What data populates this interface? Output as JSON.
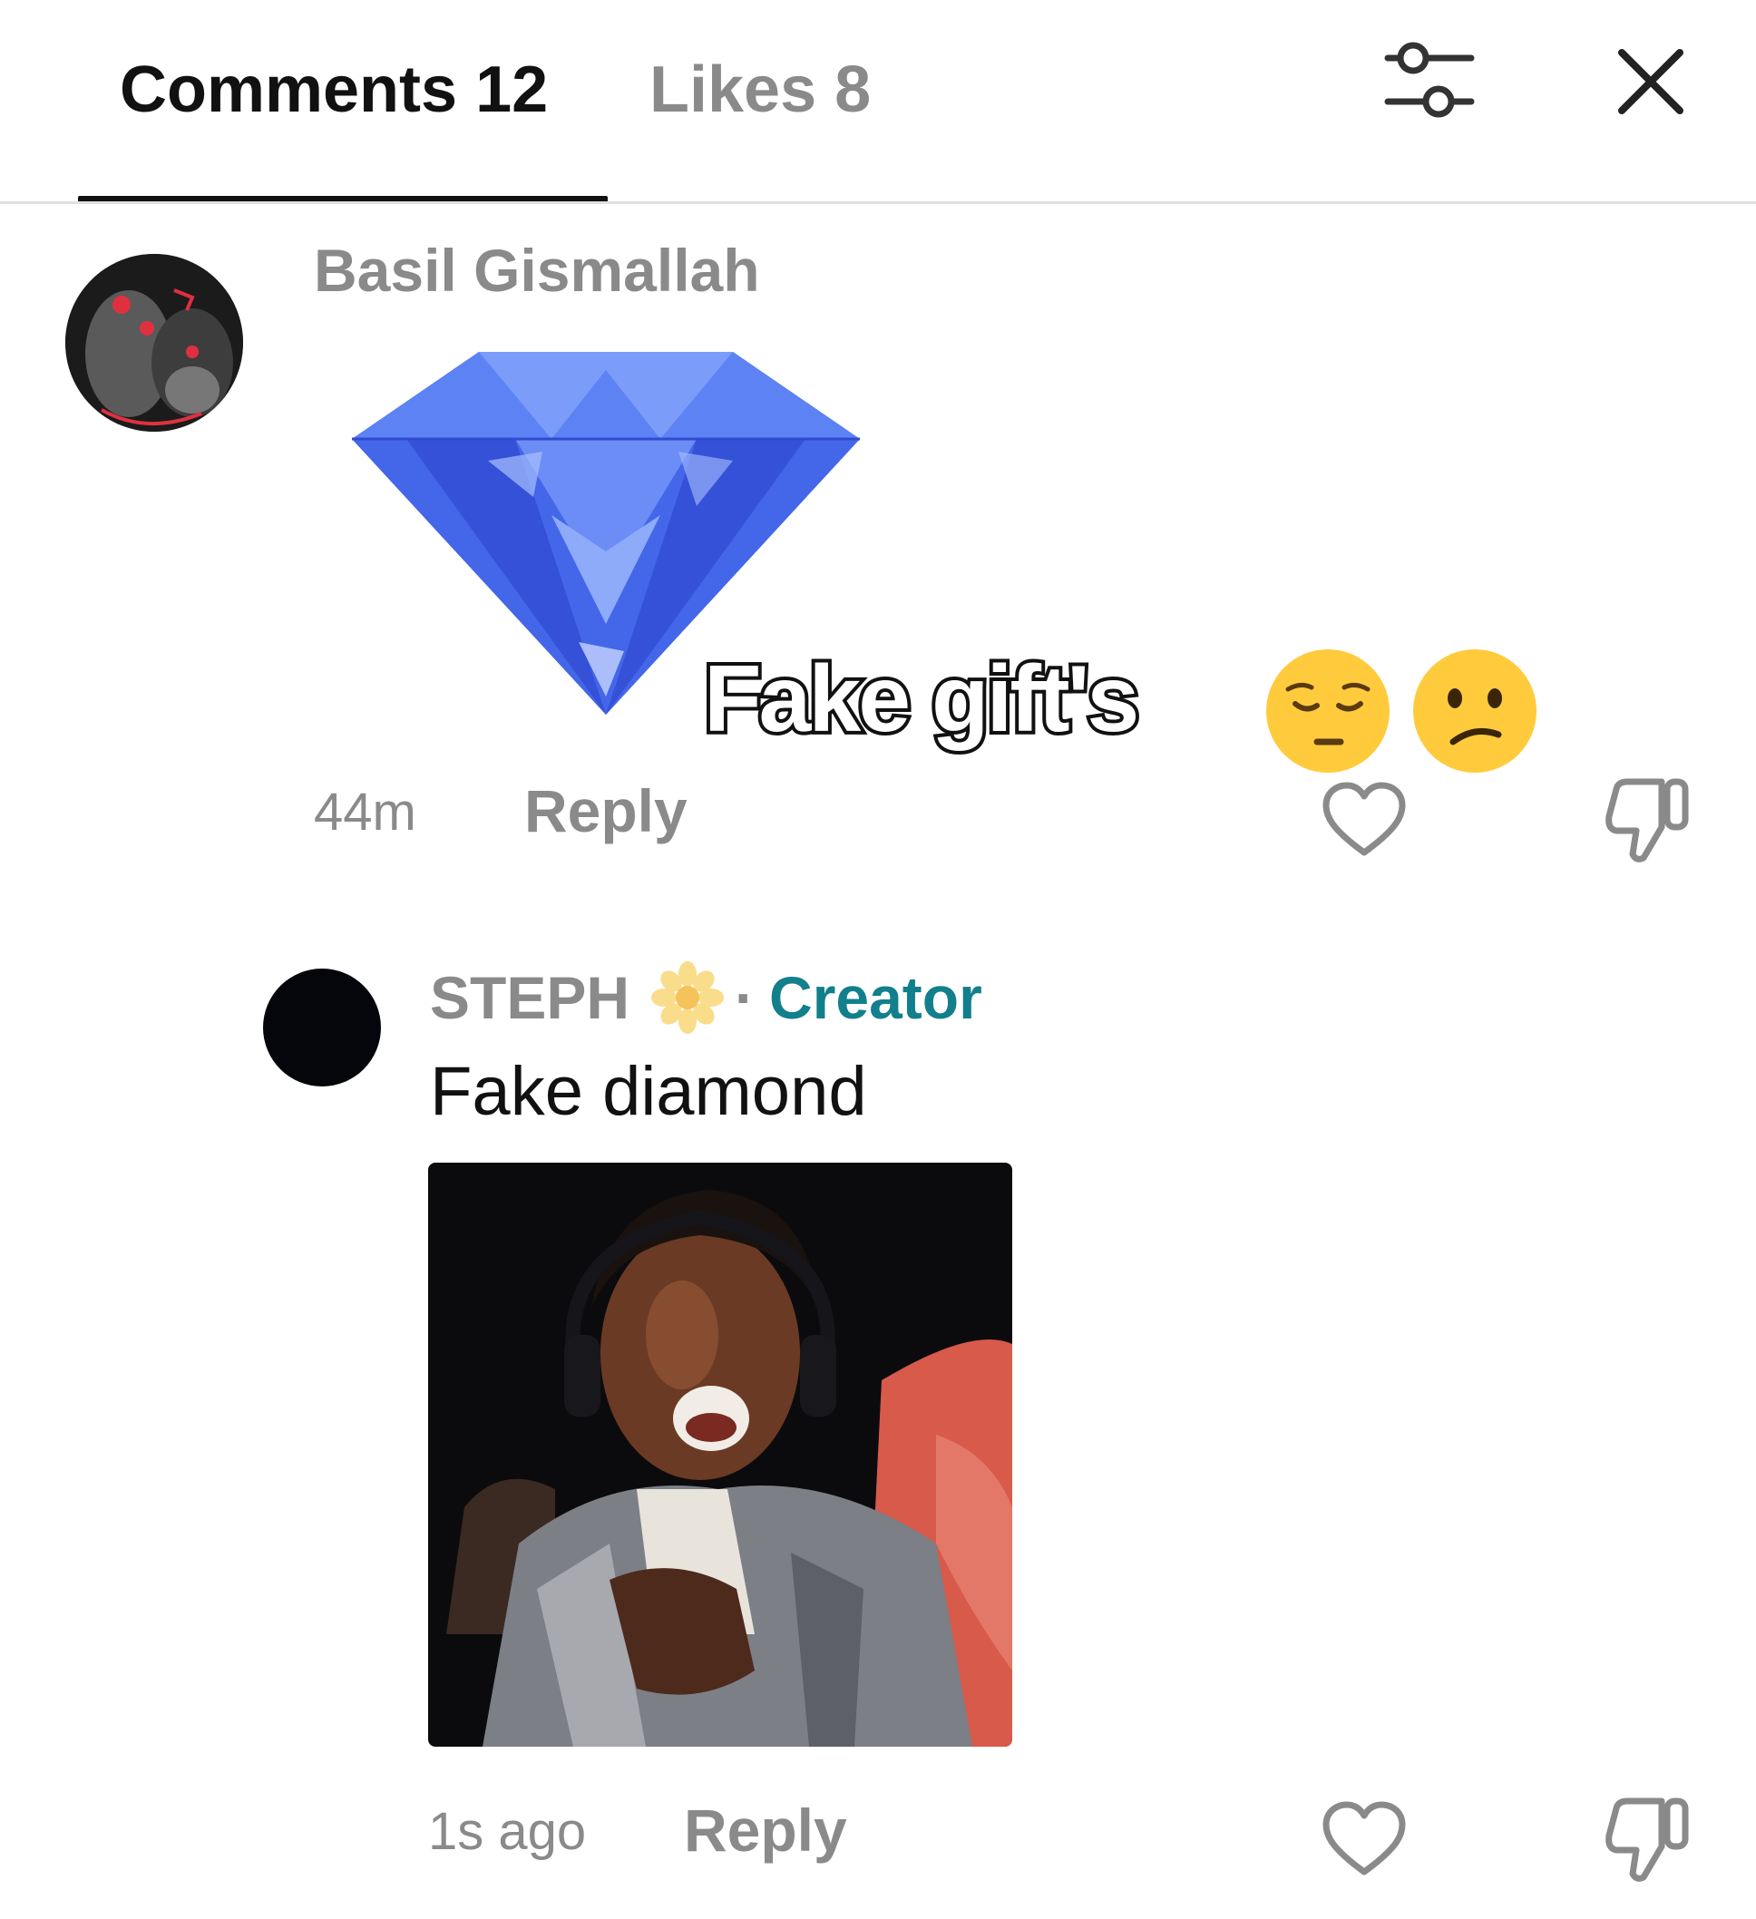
{
  "header": {
    "tabs": [
      {
        "label": "Comments 12",
        "active": true
      },
      {
        "label": "Likes 8",
        "active": false
      }
    ],
    "filter_icon": "sliders-icon",
    "close_icon": "close-icon"
  },
  "comments": [
    {
      "username": "Basil Gismallah",
      "avatar": "avatar-image",
      "sticker": "blue-diamond-sticker",
      "overlay_text": "Fake gift's",
      "overlay_emojis": [
        "pensive-face-emoji",
        "confused-face-emoji"
      ],
      "time": "44m",
      "reply_label": "Reply",
      "like_icon": "heart-icon",
      "dislike_icon": "thumbs-down-icon"
    },
    {
      "username": "STEPH",
      "name_emoji": "flower-icon",
      "separator": "·",
      "badge": "Creator",
      "text": "Fake diamond",
      "attachment": "reaction-gif",
      "time": "1s ago",
      "reply_label": "Reply",
      "like_icon": "heart-icon",
      "dislike_icon": "thumbs-down-icon"
    }
  ],
  "colors": {
    "active_tab": "#111111",
    "muted_text": "#8a8a8a",
    "creator_badge": "#127f8c",
    "diamond": "#3f63e6"
  }
}
